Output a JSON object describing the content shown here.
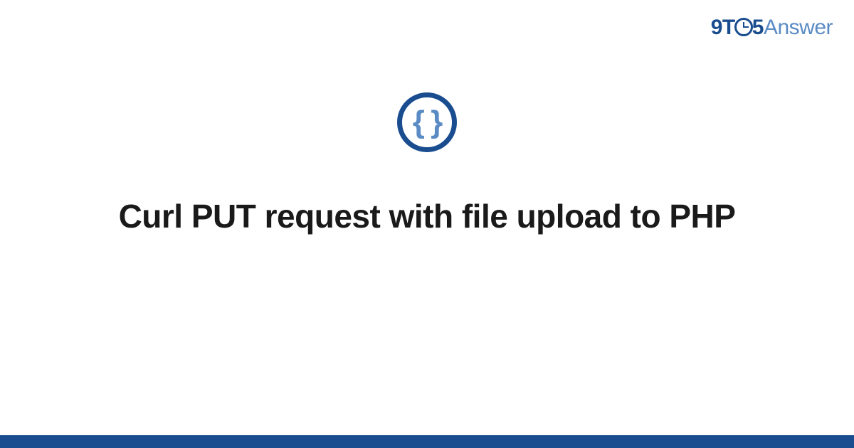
{
  "logo": {
    "part1": "9T",
    "part2": "5",
    "part3": "Answer"
  },
  "category_icon": {
    "symbol": "{ }"
  },
  "title": "Curl PUT request with file upload to PHP"
}
